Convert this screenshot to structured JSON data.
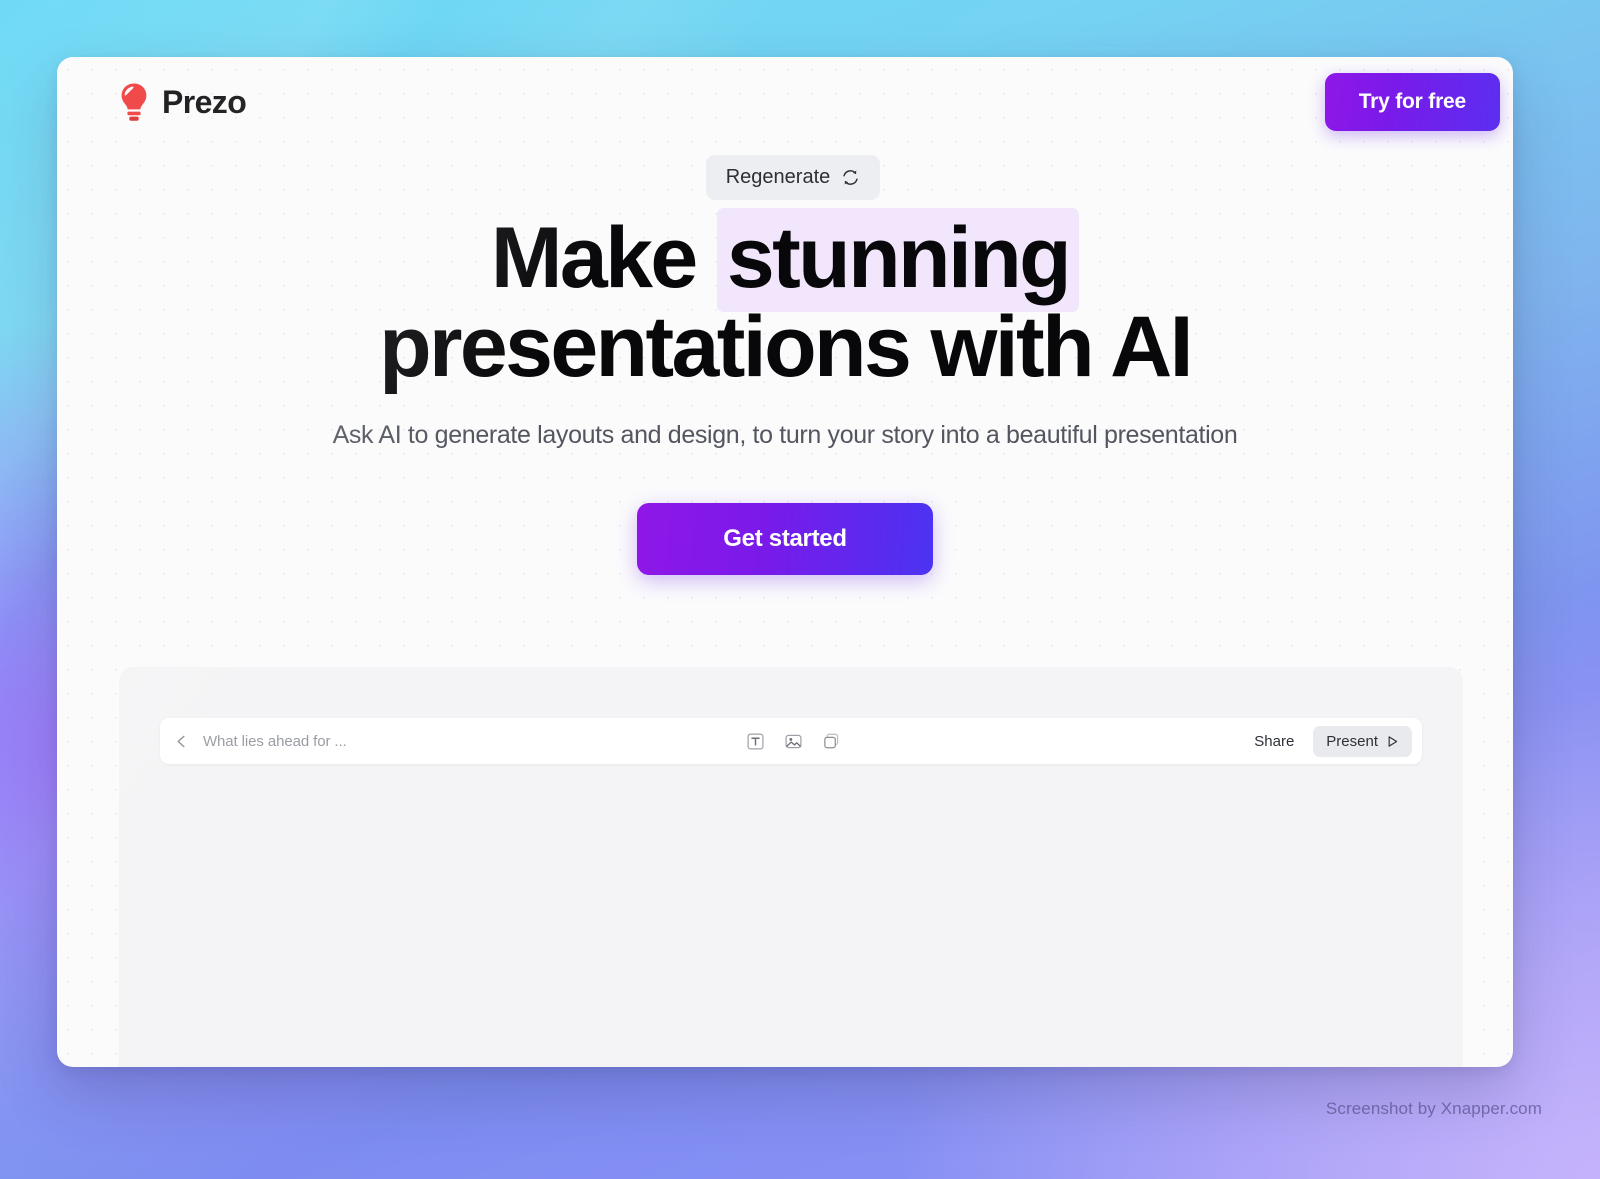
{
  "background": {
    "gradient_from": "#6ad9f5",
    "gradient_mid": "#7f8cf0",
    "gradient_to": "#c6b4fc",
    "accent_purple": "#7a1ae9"
  },
  "window": {
    "brand": {
      "name": "Prezo",
      "logo_icon": "lightbulb-icon",
      "logo_color": "#ef3b3b"
    },
    "cta": {
      "try_for_free_label": "Try for free",
      "gradient_from": "#8f17e8",
      "gradient_to": "#5b2ff0"
    }
  },
  "hero": {
    "regenerate": {
      "label": "Regenerate",
      "icon": "refresh-cycle-icon"
    },
    "headline": {
      "part_1": "Make ",
      "highlight": "stunning",
      "part_2": " presentations with AI",
      "highlight_color": "#f1e6fb"
    },
    "subheadline": "Ask AI to generate layouts and design, to turn your story into a beautiful presentation",
    "primary_button": {
      "label": "Get started",
      "gradient_from": "#8f17e8",
      "gradient_to": "#4b33f2"
    }
  },
  "editor": {
    "toolbar": {
      "back_icon": "chevron-left-icon",
      "document_title": "What lies ahead for ...",
      "tools": [
        {
          "name": "text-tool-icon",
          "label": "Text"
        },
        {
          "name": "image-tool-icon",
          "label": "Image"
        },
        {
          "name": "shape-tool-icon",
          "label": "Shape"
        }
      ],
      "share_label": "Share",
      "present_label": "Present",
      "present_icon": "play-triangle-icon"
    }
  },
  "watermark": "Screenshot by Xnapper.com"
}
